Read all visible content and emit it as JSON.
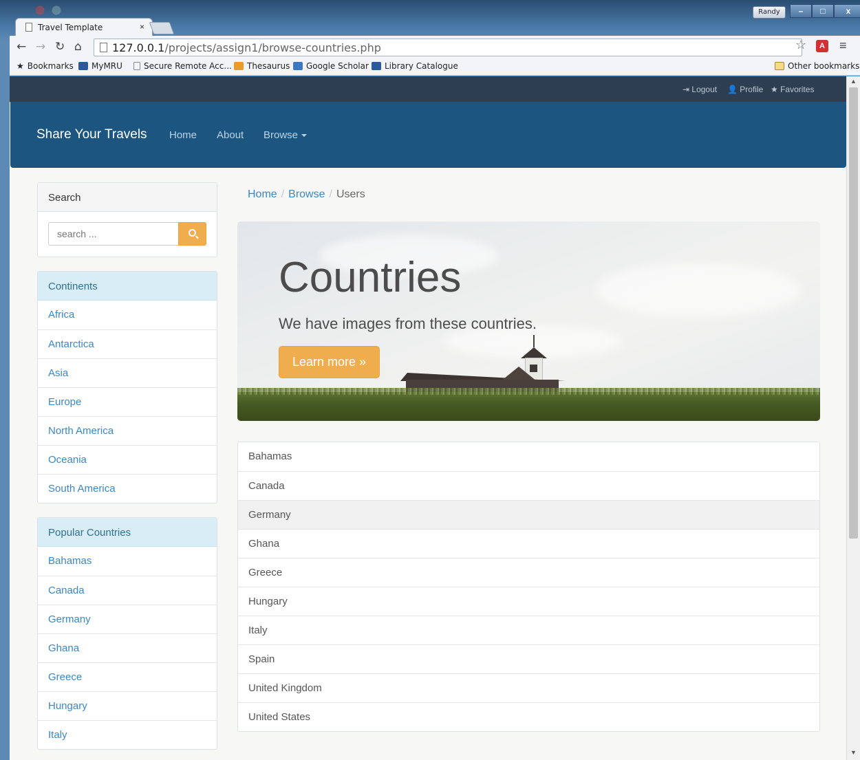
{
  "browser": {
    "tab_title": "Travel Template",
    "tab_close": "×",
    "url_host": "127.0.0.1",
    "url_path": "/projects/assign1/browse-countries.php",
    "profile_name": "Randy",
    "window_buttons": {
      "minimize": "–",
      "maximize": "□",
      "close": "x"
    },
    "bookmarks": [
      "Bookmarks",
      "MyMRU",
      "Secure Remote Acc...",
      "Thesaurus",
      "Google Scholar",
      "Library Catalogue"
    ],
    "other_bookmarks": "Other bookmarks"
  },
  "topbar": {
    "logout": "Logout",
    "profile": "Profile",
    "favorites": "Favorites"
  },
  "nav": {
    "brand": "Share Your Travels",
    "home": "Home",
    "about": "About",
    "browse": "Browse"
  },
  "search": {
    "title": "Search",
    "placeholder": "search ..."
  },
  "continents": {
    "title": "Continents",
    "items": [
      "Africa",
      "Antarctica",
      "Asia",
      "Europe",
      "North America",
      "Oceania",
      "South America"
    ]
  },
  "popular": {
    "title": "Popular Countries",
    "items": [
      "Bahamas",
      "Canada",
      "Germany",
      "Ghana",
      "Greece",
      "Hungary",
      "Italy"
    ]
  },
  "breadcrumb": {
    "home": "Home",
    "browse": "Browse",
    "current": "Users",
    "separator": "/"
  },
  "jumbotron": {
    "title": "Countries",
    "subtitle": "We have images from these countries.",
    "button": "Learn more »"
  },
  "countries": [
    "Bahamas",
    "Canada",
    "Germany",
    "Ghana",
    "Greece",
    "Hungary",
    "Italy",
    "Spain",
    "United Kingdom",
    "United States"
  ],
  "colors": {
    "navbar": "#1c5680",
    "topbar": "#2c3e50",
    "accent": "#f0ad4e",
    "link": "#3a87c6"
  }
}
